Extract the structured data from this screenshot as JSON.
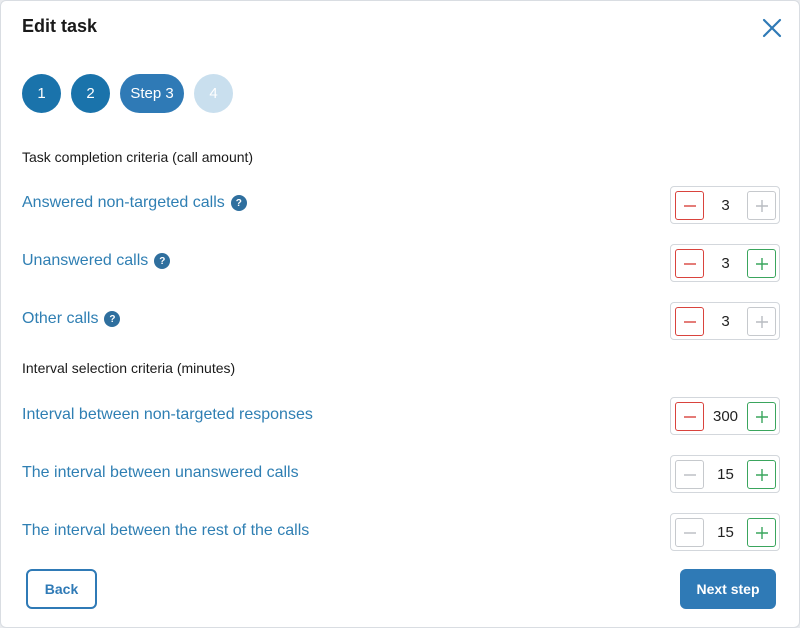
{
  "modal": {
    "title": "Edit task"
  },
  "steps": [
    {
      "label": "1",
      "state": "done"
    },
    {
      "label": "2",
      "state": "done"
    },
    {
      "label": "Step 3",
      "state": "active"
    },
    {
      "label": "4",
      "state": "pending"
    }
  ],
  "sections": {
    "completion": "Task completion criteria (call amount)",
    "interval": "Interval selection criteria (minutes)"
  },
  "rows": [
    {
      "label": "Answered non-targeted calls",
      "help": "?",
      "value": "3",
      "minus": "red",
      "plus": "grey"
    },
    {
      "label": "Unanswered calls",
      "help": "?",
      "value": "3",
      "minus": "red",
      "plus": "green"
    },
    {
      "label": "Other calls",
      "help": "?",
      "value": "3",
      "minus": "red",
      "plus": "grey"
    },
    {
      "label": "Interval between non-targeted responses",
      "value": "300",
      "minus": "red",
      "plus": "green"
    },
    {
      "label": "The interval between unanswered calls",
      "value": "15",
      "minus": "grey",
      "plus": "green"
    },
    {
      "label": "The interval between the rest of the calls",
      "value": "15",
      "minus": "grey",
      "plus": "green"
    }
  ],
  "footer": {
    "back": "Back",
    "next": "Next step"
  },
  "colors": {
    "accent": "#2f7ab6",
    "minus_active": "#d9433d",
    "plus_active": "#3aa55d",
    "disabled": "#c6c9cd"
  }
}
